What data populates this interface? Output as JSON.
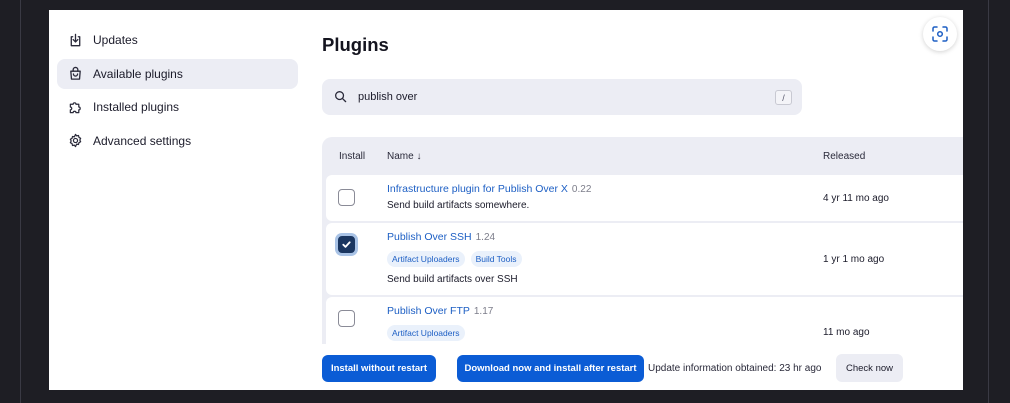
{
  "sidebar": {
    "items": [
      {
        "label": "Updates",
        "icon": "download-icon"
      },
      {
        "label": "Available plugins",
        "icon": "shopping-bag-icon"
      },
      {
        "label": "Installed plugins",
        "icon": "puzzle-icon"
      },
      {
        "label": "Advanced settings",
        "icon": "gear-icon"
      }
    ],
    "active_index": 1
  },
  "page": {
    "title": "Plugins"
  },
  "search": {
    "value": "publish over",
    "shortcut": "/"
  },
  "table": {
    "headers": {
      "install": "Install",
      "name": "Name ↓",
      "released": "Released"
    },
    "rows": [
      {
        "name": "Infrastructure plugin for Publish Over X",
        "version": "0.22",
        "tags": [],
        "description": "Send build artifacts somewhere.",
        "released": "4 yr 11 mo ago",
        "checked": false
      },
      {
        "name": "Publish Over SSH",
        "version": "1.24",
        "tags": [
          "Artifact Uploaders",
          "Build Tools"
        ],
        "description": "Send build artifacts over SSH",
        "released": "1 yr 1 mo ago",
        "checked": true
      },
      {
        "name": "Publish Over FTP",
        "version": "1.17",
        "tags": [
          "Artifact Uploaders"
        ],
        "description": "",
        "released": "11 mo ago",
        "checked": false
      }
    ]
  },
  "footer": {
    "install_without_restart": "Install without restart",
    "download_and_install": "Download now and install after restart",
    "update_info": "Update information obtained: 23 hr ago",
    "check_now": "Check now"
  },
  "colors": {
    "accent": "#0b5cd5",
    "link": "#1d5fc4",
    "checked": "#1a3660",
    "panel": "#ecedf4"
  }
}
